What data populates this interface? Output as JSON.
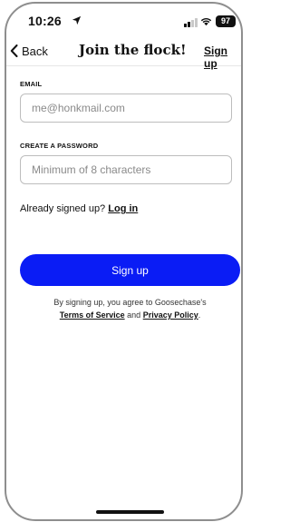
{
  "status_bar": {
    "time": "10:26",
    "battery": "97",
    "icons": [
      "location-arrow-icon",
      "signal-icon",
      "wifi-icon",
      "battery-icon"
    ]
  },
  "nav": {
    "back_label": "Back",
    "title": "Join the flock!",
    "signup_label": "Sign up"
  },
  "form": {
    "email_label": "EMAIL",
    "email_placeholder": "me@honkmail.com",
    "email_value": "",
    "password_label": "CREATE A PASSWORD",
    "password_placeholder": "Minimum of 8 characters",
    "password_value": "",
    "already_text": "Already signed up?",
    "login_label": "Log in",
    "submit_label": "Sign up"
  },
  "legal": {
    "prefix": "By signing up, you agree to Goosechase's",
    "terms_label": "Terms of Service",
    "and_text": "and",
    "privacy_label": "Privacy Policy",
    "suffix": "."
  },
  "colors": {
    "primary_button": "#0a1cf5",
    "text": "#111111",
    "input_border": "#bdbdbd"
  }
}
